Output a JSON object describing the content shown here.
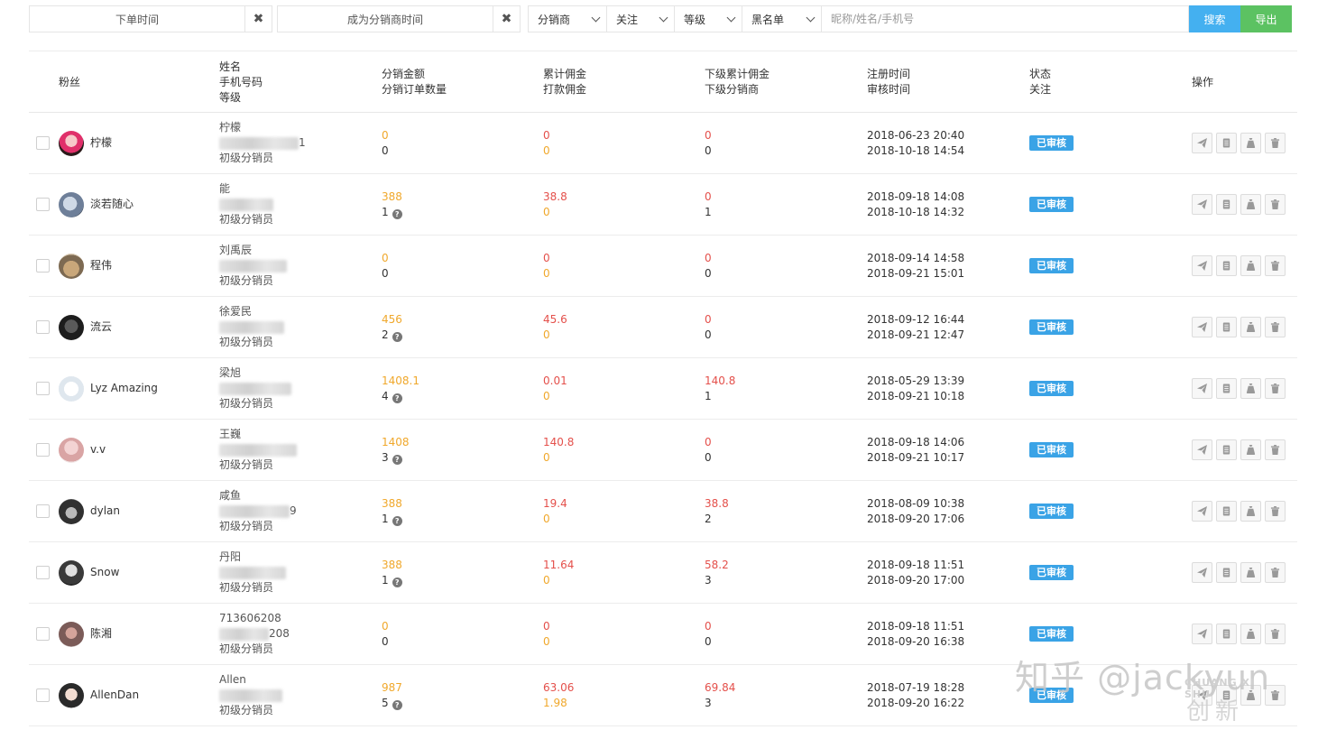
{
  "filters": {
    "order_time_placeholder": "下单时间",
    "distributor_time_placeholder": "成为分销商时间",
    "clear_symbol": "✖",
    "selects": [
      "分销商",
      "关注",
      "等级",
      "黑名单"
    ],
    "search_placeholder": "昵称/姓名/手机号",
    "search_label": "搜索",
    "export_label": "导出"
  },
  "table": {
    "headers": {
      "fans": "粉丝",
      "name_l1": "姓名",
      "name_l2": "手机号码",
      "name_l3": "等级",
      "amount_l1": "分销金额",
      "amount_l2": "分销订单数量",
      "comm_l1": "累计佣金",
      "comm_l2": "打款佣金",
      "sub_l1": "下级累计佣金",
      "sub_l2": "下级分销商",
      "time_l1": "注册时间",
      "time_l2": "审核时间",
      "status_l1": "状态",
      "status_l2": "关注",
      "ops": "操作"
    },
    "rows": [
      {
        "fan": "柠檬",
        "name": "柠檬",
        "phone_suffix": "1",
        "level": "初级分销员",
        "amount": "0",
        "orders": "0",
        "orders_help": false,
        "total_comm": "0",
        "paid_comm": "0",
        "sub_comm": "0",
        "sub_count": "0",
        "reg_time": "2018-06-23 20:40",
        "audit_time": "2018-10-18 14:54",
        "status": "已审核"
      },
      {
        "fan": "淡若随心",
        "name": "能",
        "phone_suffix": "",
        "level": "初级分销员",
        "amount": "388",
        "orders": "1",
        "orders_help": true,
        "total_comm": "38.8",
        "paid_comm": "0",
        "sub_comm": "0",
        "sub_count": "1",
        "reg_time": "2018-09-18 14:08",
        "audit_time": "2018-10-18 14:32",
        "status": "已审核"
      },
      {
        "fan": "程伟",
        "name": "刘禹辰",
        "phone_suffix": "",
        "level": "初级分销员",
        "amount": "0",
        "orders": "0",
        "orders_help": false,
        "total_comm": "0",
        "paid_comm": "0",
        "sub_comm": "0",
        "sub_count": "0",
        "reg_time": "2018-09-14 14:58",
        "audit_time": "2018-09-21 15:01",
        "status": "已审核"
      },
      {
        "fan": "流云",
        "name": "徐爱民",
        "phone_suffix": "",
        "level": "初级分销员",
        "amount": "456",
        "orders": "2",
        "orders_help": true,
        "total_comm": "45.6",
        "paid_comm": "0",
        "sub_comm": "0",
        "sub_count": "0",
        "reg_time": "2018-09-12 16:44",
        "audit_time": "2018-09-21 12:47",
        "status": "已审核"
      },
      {
        "fan": "Lyz Amazing",
        "name": "梁旭",
        "phone_suffix": "",
        "level": "初级分销员",
        "amount": "1408.1",
        "orders": "4",
        "orders_help": true,
        "total_comm": "0.01",
        "paid_comm": "0",
        "sub_comm": "140.8",
        "sub_count": "1",
        "reg_time": "2018-05-29 13:39",
        "audit_time": "2018-09-21 10:18",
        "status": "已审核"
      },
      {
        "fan": "v.v",
        "name": "王巍",
        "phone_suffix": "",
        "level": "初级分销员",
        "amount": "1408",
        "orders": "3",
        "orders_help": true,
        "total_comm": "140.8",
        "paid_comm": "0",
        "sub_comm": "0",
        "sub_count": "0",
        "reg_time": "2018-09-18 14:06",
        "audit_time": "2018-09-21 10:17",
        "status": "已审核"
      },
      {
        "fan": "dylan",
        "name": "咸鱼",
        "phone_suffix": "9",
        "level": "初级分销员",
        "amount": "388",
        "orders": "1",
        "orders_help": true,
        "total_comm": "19.4",
        "paid_comm": "0",
        "sub_comm": "38.8",
        "sub_count": "2",
        "reg_time": "2018-08-09 10:38",
        "audit_time": "2018-09-20 17:06",
        "status": "已审核"
      },
      {
        "fan": "Snow",
        "name": "丹阳",
        "phone_suffix": "",
        "level": "初级分销员",
        "amount": "388",
        "orders": "1",
        "orders_help": true,
        "total_comm": "11.64",
        "paid_comm": "0",
        "sub_comm": "58.2",
        "sub_count": "3",
        "reg_time": "2018-09-18 11:51",
        "audit_time": "2018-09-20 17:00",
        "status": "已审核"
      },
      {
        "fan": "陈湘",
        "name": "713606208",
        "phone_suffix": "208",
        "level": "初级分销员",
        "amount": "0",
        "orders": "0",
        "orders_help": false,
        "total_comm": "0",
        "paid_comm": "0",
        "sub_comm": "0",
        "sub_count": "0",
        "reg_time": "2018-09-18 11:51",
        "audit_time": "2018-09-20 16:38",
        "status": "已审核"
      },
      {
        "fan": "AllenDan",
        "name": "Allen",
        "phone_suffix": "",
        "level": "初级分销员",
        "amount": "987",
        "orders": "5",
        "orders_help": true,
        "total_comm": "63.06",
        "paid_comm": "1.98",
        "sub_comm": "69.84",
        "sub_count": "3",
        "reg_time": "2018-07-19 18:28",
        "audit_time": "2018-09-20 16:22",
        "status": "已审核"
      }
    ]
  },
  "watermark": {
    "main": "知乎 @jackyun",
    "sub": "CHUANG XI SHU",
    "cn": "创新互联"
  },
  "colors": {
    "yellow": "#f0a82c",
    "red": "#e4504b",
    "badge": "#3aa3e6",
    "search_btn": "#44b0f0",
    "export_btn": "#5cc262"
  }
}
